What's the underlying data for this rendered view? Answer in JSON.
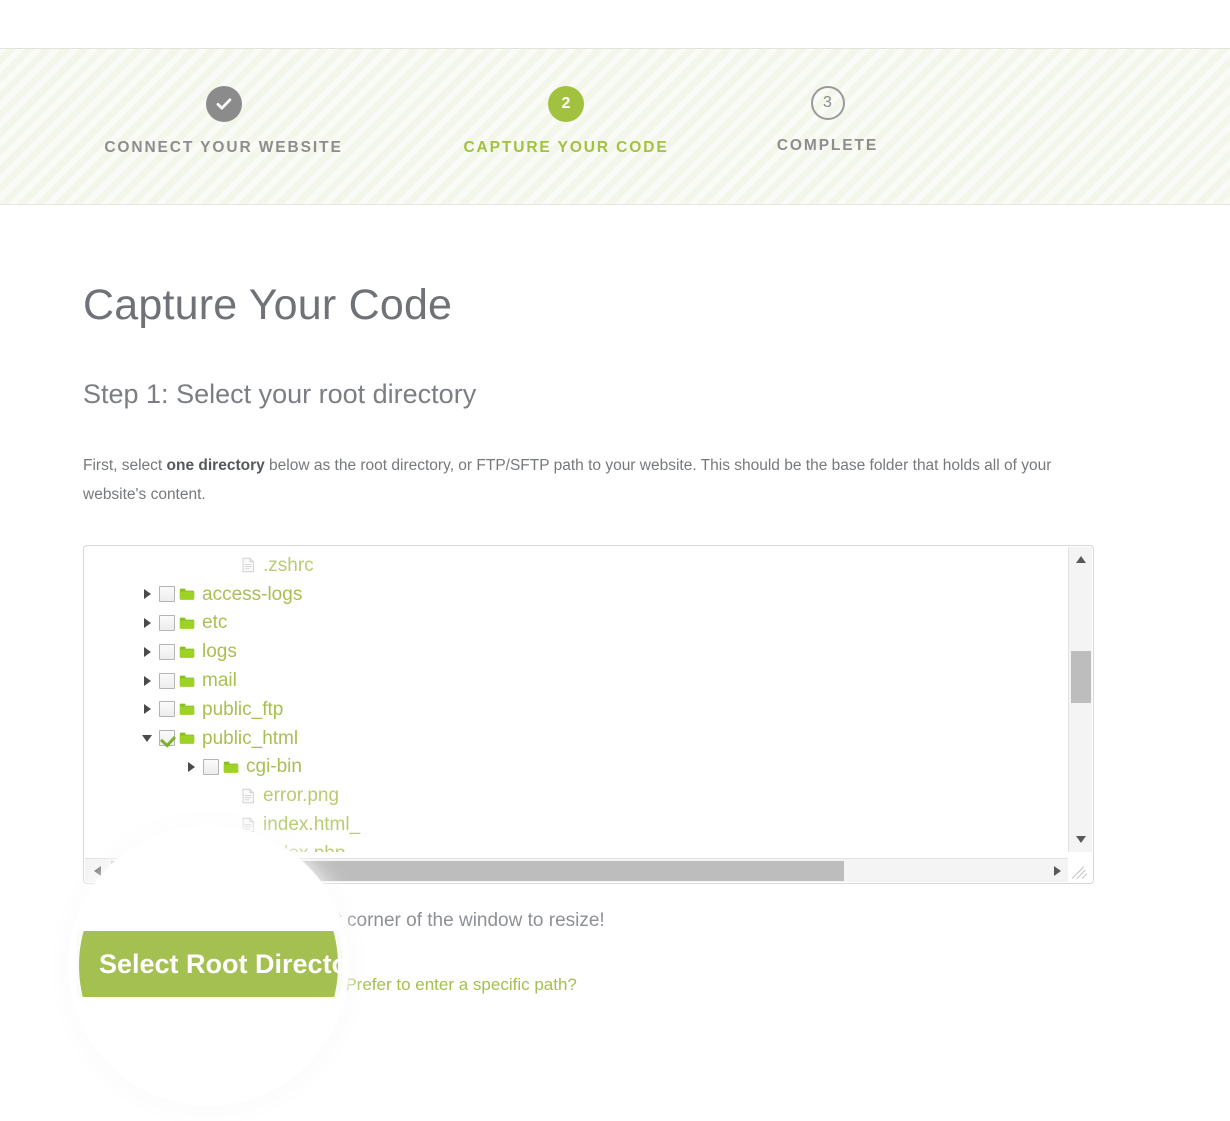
{
  "wizard": {
    "steps": [
      {
        "id": "connect",
        "marker": "check-icon",
        "label": "CONNECT YOUR WEBSITE",
        "state": "done"
      },
      {
        "id": "capture",
        "marker": "2",
        "label": "CAPTURE YOUR CODE",
        "state": "active"
      },
      {
        "id": "complete",
        "marker": "3",
        "label": "COMPLETE",
        "state": "todo"
      }
    ]
  },
  "page": {
    "title": "Capture Your Code",
    "section_title": "Step 1: Select your root directory",
    "lede_part1": "First, select ",
    "lede_strong": "one directory",
    "lede_part2": " below as the root directory, or FTP/SFTP path to your website. This should be the base folder that holds all of your website's content."
  },
  "tree": {
    "items": [
      {
        "name": ".zshrc",
        "type": "file",
        "indent": "lvl2f",
        "arrow": "none",
        "checked": false,
        "hasCheckbox": false
      },
      {
        "name": "access-logs",
        "type": "folder",
        "indent": "lvl1",
        "arrow": "right",
        "checked": false,
        "hasCheckbox": true
      },
      {
        "name": "etc",
        "type": "folder",
        "indent": "lvl1",
        "arrow": "right",
        "checked": false,
        "hasCheckbox": true
      },
      {
        "name": "logs",
        "type": "folder",
        "indent": "lvl1",
        "arrow": "right",
        "checked": false,
        "hasCheckbox": true
      },
      {
        "name": "mail",
        "type": "folder",
        "indent": "lvl1",
        "arrow": "right",
        "checked": false,
        "hasCheckbox": true
      },
      {
        "name": "public_ftp",
        "type": "folder",
        "indent": "lvl1",
        "arrow": "right",
        "checked": false,
        "hasCheckbox": true
      },
      {
        "name": "public_html",
        "type": "folder",
        "indent": "lvl1",
        "arrow": "down",
        "checked": true,
        "hasCheckbox": true
      },
      {
        "name": "cgi-bin",
        "type": "folder",
        "indent": "lvl2",
        "arrow": "right",
        "checked": false,
        "hasCheckbox": true
      },
      {
        "name": "error.png",
        "type": "file",
        "indent": "lvl2f",
        "arrow": "none",
        "checked": false,
        "hasCheckbox": false
      },
      {
        "name": "index.html_",
        "type": "file",
        "indent": "lvl2f",
        "arrow": "none",
        "checked": false,
        "hasCheckbox": false
      },
      {
        "name": "index.php",
        "type": "file",
        "indent": "lvl2f",
        "arrow": "none",
        "checked": false,
        "hasCheckbox": false
      }
    ]
  },
  "hint": "Click and drag the bottom right corner of the window to resize!",
  "actions": {
    "primary_label": "Select Root Directory",
    "alt_link_label": "Prefer to enter a specific path?"
  },
  "magnifier": {
    "button_label": "Select Root Directory"
  },
  "colors": {
    "accent_green": "#a3c051",
    "tree_green": "#a9c050",
    "file_green": "#b8cc72",
    "step_done_gray": "#8b8b8b",
    "band_bg": "#f3f6ea"
  }
}
